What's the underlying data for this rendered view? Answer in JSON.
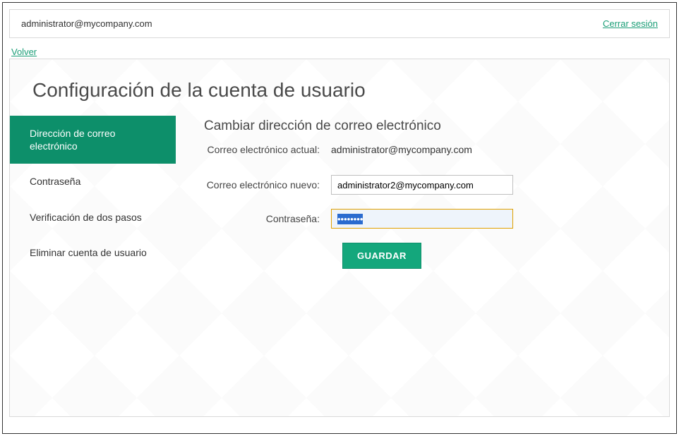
{
  "header": {
    "user_email": "administrator@mycompany.com",
    "logout_label": "Cerrar sesión"
  },
  "back_label": "Volver",
  "page_title": "Configuración de la cuenta de usuario",
  "sidebar": {
    "items": [
      {
        "label": "Dirección de correo electrónico",
        "active": true
      },
      {
        "label": "Contraseña",
        "active": false
      },
      {
        "label": "Verificación de dos pasos",
        "active": false
      },
      {
        "label": "Eliminar cuenta de usuario",
        "active": false
      }
    ]
  },
  "form": {
    "title": "Cambiar dirección de correo electrónico",
    "current_email_label": "Correo electrónico actual:",
    "current_email_value": "administrator@mycompany.com",
    "new_email_label": "Correo electrónico nuevo:",
    "new_email_value": "administrator2@mycompany.com",
    "password_label": "Contraseña:",
    "password_value": "••••••••",
    "save_label": "GUARDAR"
  }
}
